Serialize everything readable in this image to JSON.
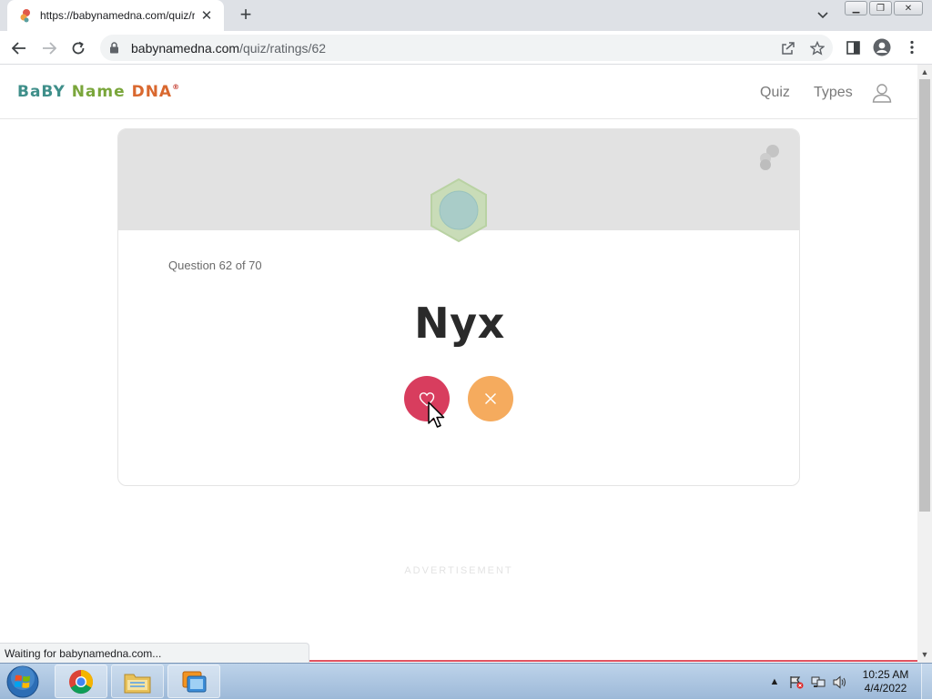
{
  "browser": {
    "tab": {
      "title": "https://babynamedna.com/quiz/r",
      "favicon": "babynamedna-favicon"
    },
    "address": {
      "host": "babynamedna.com",
      "path": "/quiz/ratings/62"
    },
    "status_text": "Waiting for babynamedna.com..."
  },
  "site": {
    "logo": {
      "part1": "BaBY",
      "part2": "Name",
      "part3": "DNA",
      "reg": "®"
    },
    "nav": {
      "quiz": "Quiz",
      "types": "Types"
    }
  },
  "quiz": {
    "counter": "Question 62 of 70",
    "name": "Nyx",
    "like_icon": "heart-icon",
    "dislike_icon": "close-icon"
  },
  "ad": {
    "label": "ADVERTISEMENT"
  },
  "taskbar": {
    "apps": [
      "chrome",
      "windows-explorer",
      "vmware"
    ],
    "clock": {
      "time": "10:25 AM",
      "date": "4/4/2022"
    }
  },
  "colors": {
    "like": "#d83d5e",
    "dislike": "#f5ab5e",
    "banner": "#e2e2e2",
    "logo_teal": "#3f8f8a",
    "logo_green": "#7aa63b",
    "logo_red": "#c8463a"
  }
}
